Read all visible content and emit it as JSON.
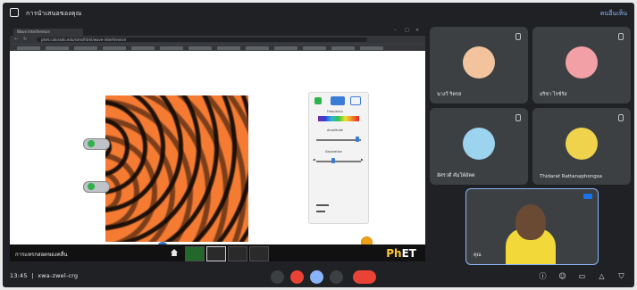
{
  "topbar": {
    "title": "การนำเสนอของคุณ",
    "right_label": "คนอื่นเห็น"
  },
  "browser": {
    "tab_label": "Wave Interference",
    "url": "phet.colorado.edu/sims/html/wave-interference"
  },
  "sim": {
    "panel_labels": [
      "Frequency",
      "Amplitude",
      "Separation"
    ],
    "screen_label": "การแทรกสอดของคลื่น",
    "logo_ph": "Ph",
    "logo_et": "ET"
  },
  "participants": [
    {
      "name": "นางวี ริตรส",
      "avatar_color": "#f2c39d"
    },
    {
      "name": "อริชา ไรช์รัส",
      "avatar_color": "#f2a0a6"
    },
    {
      "name": "อัศรวดี คัมโพ์อัคต",
      "avatar_color": "#9cd4f0"
    },
    {
      "name": "Thidarat Rattanaphongsa",
      "avatar_color": "#f0d34c"
    }
  ],
  "self_tile": {
    "name": "คุณ"
  },
  "bottombar": {
    "time": "13:45",
    "meeting_code": "xwa-zwel-crg"
  },
  "colors": {
    "background": "#202124",
    "accent": "#8ab4f8",
    "end_call": "#ea4335",
    "wave_orange": "#f57b33"
  }
}
